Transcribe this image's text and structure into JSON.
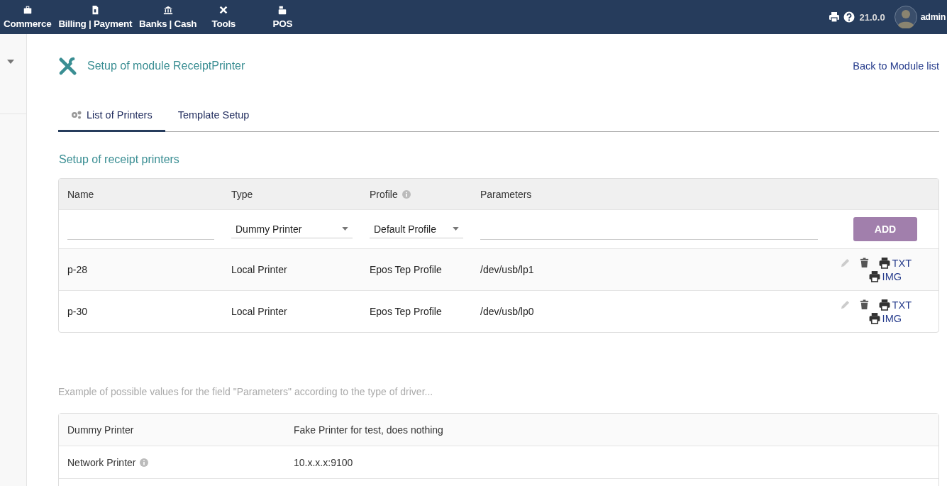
{
  "top_menu": [
    {
      "label": "Commerce"
    },
    {
      "label": "Billing | Payment"
    },
    {
      "label": "Banks | Cash"
    },
    {
      "label": "Tools"
    },
    {
      "label": "POS"
    }
  ],
  "top_right": {
    "version": "21.0.0",
    "user": "admin"
  },
  "page": {
    "title": "Setup of module ReceiptPrinter",
    "back_link": "Back to Module list"
  },
  "tabs": [
    {
      "label": "List of Printers",
      "selected": true
    },
    {
      "label": "Template Setup",
      "selected": false
    }
  ],
  "section_title": "Setup of receipt printers",
  "printers_table": {
    "columns": [
      {
        "label": "Name",
        "info": false
      },
      {
        "label": "Type",
        "info": false
      },
      {
        "label": "Profile",
        "info": true
      },
      {
        "label": "Parameters",
        "info": false
      }
    ],
    "new_row": {
      "type": "Dummy Printer",
      "profile": "Default Profile",
      "add_button": "ADD"
    },
    "rows": [
      {
        "name": "p-28",
        "type": "Local Printer",
        "profile": "Epos Tep Profile",
        "parameters": "/dev/usb/lp1",
        "txt": "TXT",
        "img": "IMG"
      },
      {
        "name": "p-30",
        "type": "Local Printer",
        "profile": "Epos Tep Profile",
        "parameters": "/dev/usb/lp0",
        "txt": "TXT",
        "img": "IMG"
      }
    ]
  },
  "examples_note": "Example of possible values for the field \"Parameters\" according to the type of driver...",
  "examples_table": [
    {
      "driver": "Dummy Printer",
      "info": false,
      "value": "Fake Printer for test, does nothing"
    },
    {
      "driver": "Network Printer",
      "info": true,
      "value": "10.x.x.x:9100"
    }
  ]
}
